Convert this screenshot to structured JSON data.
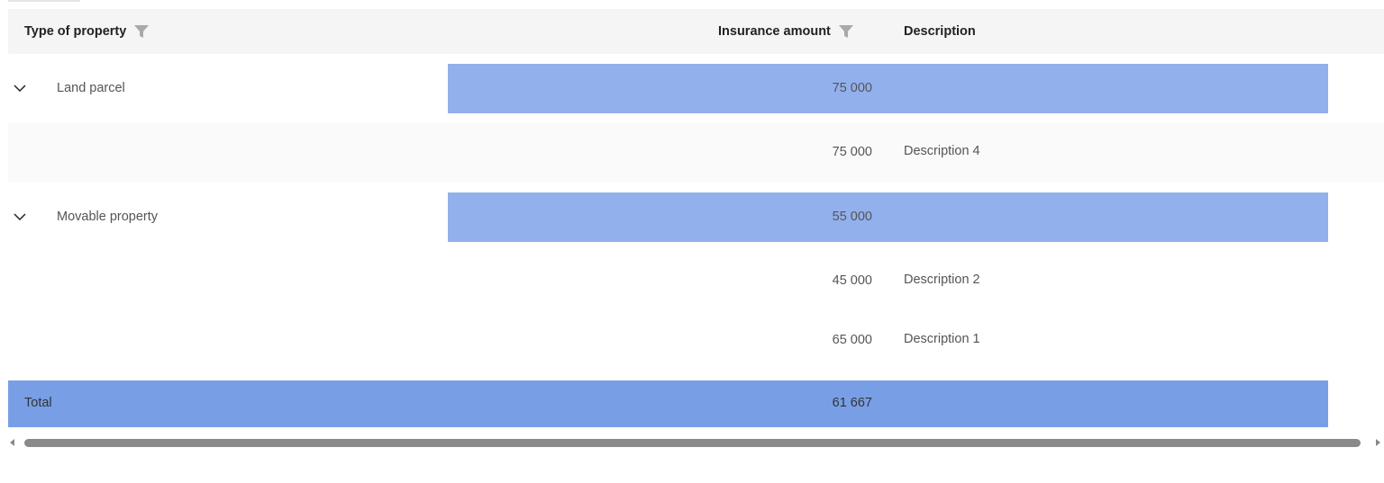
{
  "header": {
    "type_of_property": "Type of property",
    "insurance_amount": "Insurance amount",
    "description": "Description"
  },
  "groups": [
    {
      "label": "Land parcel",
      "amount": "75 000",
      "rows": [
        {
          "amount": "75 000",
          "description": "Description 4"
        }
      ]
    },
    {
      "label": "Movable property",
      "amount": "55 000",
      "rows": [
        {
          "amount": "45 000",
          "description": "Description 2"
        },
        {
          "amount": "65 000",
          "description": "Description 1"
        }
      ]
    }
  ],
  "total": {
    "label": "Total",
    "amount": "61 667"
  },
  "colors": {
    "header_bg": "#f5f5f5",
    "group_band": "#92b0ec",
    "total_band": "#789fe6",
    "scrollbar_thumb": "#8a8a8a"
  },
  "icons": {
    "filter": "filter-icon",
    "expand": "chevron-down-icon"
  }
}
